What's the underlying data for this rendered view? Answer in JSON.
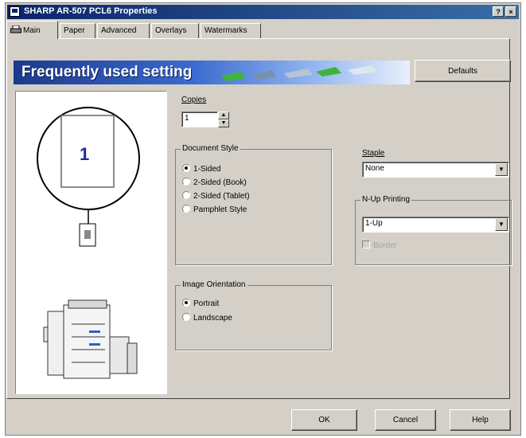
{
  "window": {
    "title": "SHARP AR-507 PCL6 Properties",
    "help_button": "?",
    "close_button": "×"
  },
  "tabs": [
    {
      "label": "Main",
      "active": true
    },
    {
      "label": "Paper",
      "active": false
    },
    {
      "label": "Advanced",
      "active": false
    },
    {
      "label": "Overlays",
      "active": false
    },
    {
      "label": "Watermarks",
      "active": false
    }
  ],
  "banner": {
    "title": "Frequently used setting"
  },
  "defaults_button": "Defaults",
  "preview": {
    "page_number": "1"
  },
  "copies": {
    "label": "Copies",
    "value": "1"
  },
  "document_style": {
    "title": "Document Style",
    "options": [
      {
        "label": "1-Sided",
        "selected": true
      },
      {
        "label": "2-Sided (Book)",
        "selected": false
      },
      {
        "label": "2-Sided (Tablet)",
        "selected": false
      },
      {
        "label": "Pamphlet Style",
        "selected": false
      }
    ]
  },
  "image_orientation": {
    "title": "Image Orientation",
    "options": [
      {
        "label": "Portrait",
        "selected": true
      },
      {
        "label": "Landscape",
        "selected": false
      }
    ]
  },
  "staple": {
    "label": "Staple",
    "value": "None"
  },
  "nup": {
    "title": "N-Up Printing",
    "value": "1-Up",
    "border_label": "Border",
    "border_enabled": false
  },
  "footer": {
    "ok": "OK",
    "cancel": "Cancel",
    "help": "Help"
  },
  "colors": {
    "titlebar_start": "#0a246a",
    "titlebar_end": "#3a6ea5",
    "dialog_face": "#d4d0c8",
    "banner_start": "#1c3a8c",
    "page_number_color": "#1a2ea0"
  }
}
